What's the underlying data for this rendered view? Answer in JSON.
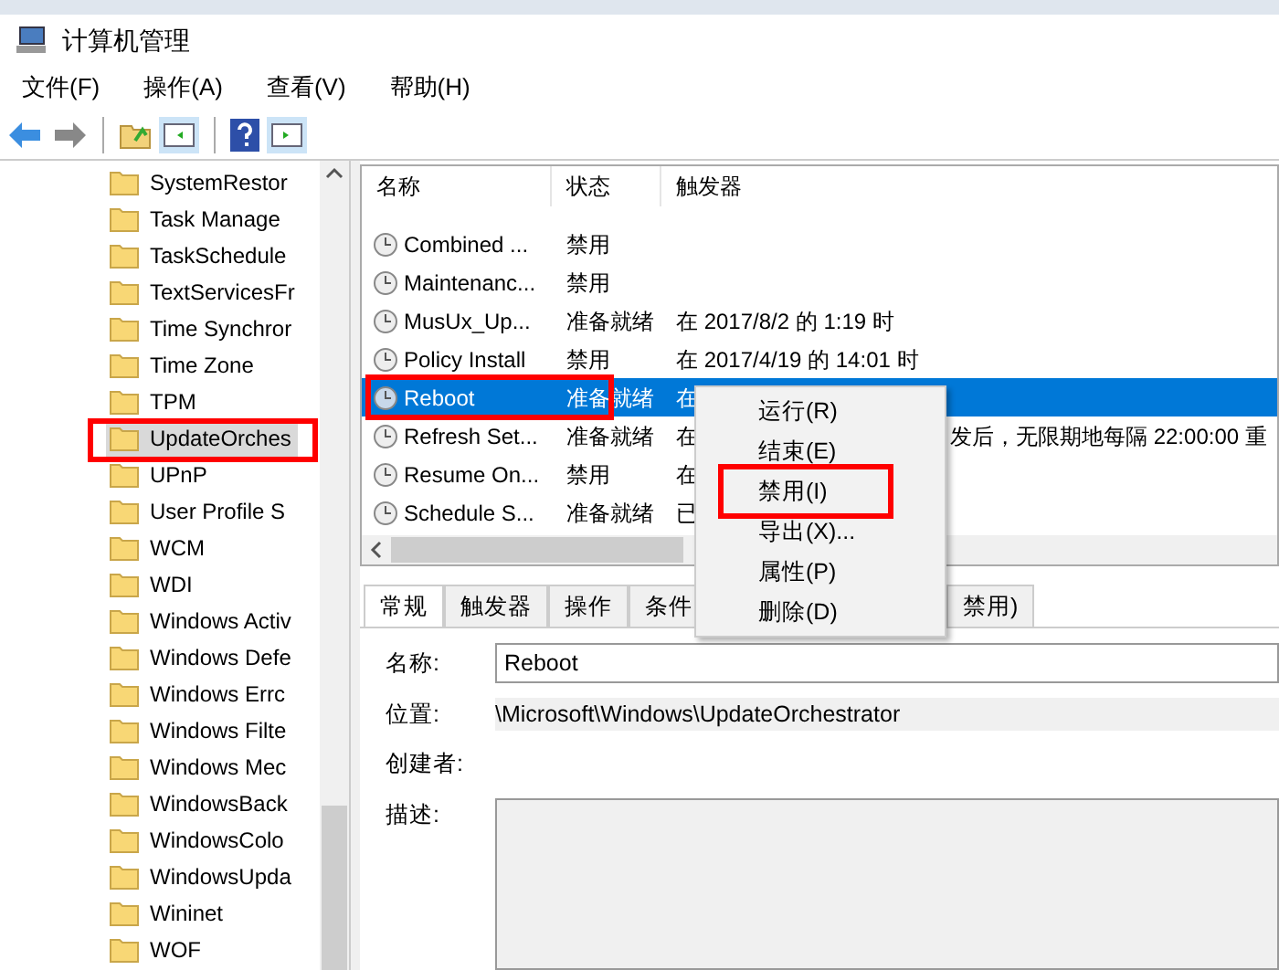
{
  "window": {
    "title": "计算机管理"
  },
  "menu_bar": [
    "文件(F)",
    "操作(A)",
    "查看(V)",
    "帮助(H)"
  ],
  "tree": {
    "items": [
      {
        "label": "SystemRestor",
        "selected": false,
        "highlighted": false
      },
      {
        "label": "Task Manage",
        "selected": false,
        "highlighted": false
      },
      {
        "label": "TaskSchedule",
        "selected": false,
        "highlighted": false
      },
      {
        "label": "TextServicesFr",
        "selected": false,
        "highlighted": false
      },
      {
        "label": "Time Synchror",
        "selected": false,
        "highlighted": false
      },
      {
        "label": "Time Zone",
        "selected": false,
        "highlighted": false
      },
      {
        "label": "TPM",
        "selected": false,
        "highlighted": false
      },
      {
        "label": "UpdateOrches",
        "selected": true,
        "highlighted": true
      },
      {
        "label": "UPnP",
        "selected": false,
        "highlighted": false
      },
      {
        "label": "User Profile S",
        "selected": false,
        "highlighted": false
      },
      {
        "label": "WCM",
        "selected": false,
        "highlighted": false
      },
      {
        "label": "WDI",
        "selected": false,
        "highlighted": false
      },
      {
        "label": "Windows Activ",
        "selected": false,
        "highlighted": false
      },
      {
        "label": "Windows Defe",
        "selected": false,
        "highlighted": false
      },
      {
        "label": "Windows Errc",
        "selected": false,
        "highlighted": false
      },
      {
        "label": "Windows Filte",
        "selected": false,
        "highlighted": false
      },
      {
        "label": "Windows Mec",
        "selected": false,
        "highlighted": false
      },
      {
        "label": "WindowsBack",
        "selected": false,
        "highlighted": false
      },
      {
        "label": "WindowsColo",
        "selected": false,
        "highlighted": false
      },
      {
        "label": "WindowsUpda",
        "selected": false,
        "highlighted": false
      },
      {
        "label": "Wininet",
        "selected": false,
        "highlighted": false
      },
      {
        "label": "WOF",
        "selected": false,
        "highlighted": false
      }
    ]
  },
  "task_table": {
    "columns": [
      "名称",
      "状态",
      "触发器"
    ],
    "rows": [
      {
        "name": "Combined ...",
        "status": "禁用",
        "trigger": "",
        "trigger_tail": "",
        "selected": false,
        "highlighted": false
      },
      {
        "name": "Maintenanc...",
        "status": "禁用",
        "trigger": "",
        "trigger_tail": "",
        "selected": false,
        "highlighted": false
      },
      {
        "name": "MusUx_Up...",
        "status": "准备就绪",
        "trigger": "在 2017/8/2 的 1:19 时",
        "trigger_tail": "",
        "selected": false,
        "highlighted": false
      },
      {
        "name": "Policy Install",
        "status": "禁用",
        "trigger": "在 2017/4/19 的 14:01 时",
        "trigger_tail": "",
        "selected": false,
        "highlighted": false
      },
      {
        "name": "Reboot",
        "status": "准备就绪",
        "trigger": "在",
        "trigger_tail": "",
        "selected": true,
        "highlighted": true
      },
      {
        "name": "Refresh Set...",
        "status": "准备就绪",
        "trigger": "在",
        "trigger_tail": "发后，无限期地每隔 22:00:00 重",
        "selected": false,
        "highlighted": false
      },
      {
        "name": "Resume On...",
        "status": "禁用",
        "trigger": "在",
        "trigger_tail": "",
        "selected": false,
        "highlighted": false
      },
      {
        "name": "Schedule S...",
        "status": "准备就绪",
        "trigger": "已",
        "trigger_tail": "",
        "selected": false,
        "highlighted": false
      }
    ]
  },
  "context_menu": [
    {
      "label": "运行(R)",
      "highlighted": false
    },
    {
      "label": "结束(E)",
      "highlighted": false
    },
    {
      "label": "禁用(I)",
      "highlighted": true
    },
    {
      "label": "导出(X)...",
      "highlighted": false
    },
    {
      "label": "属性(P)",
      "highlighted": false
    },
    {
      "label": "删除(D)",
      "highlighted": false
    }
  ],
  "detail_tabs": [
    {
      "label": "常规",
      "selected": true
    },
    {
      "label": "触发器",
      "selected": false
    },
    {
      "label": "操作",
      "selected": false
    },
    {
      "label": "条件",
      "selected": false
    },
    {
      "label": "禁用)",
      "selected": false
    }
  ],
  "general": {
    "name_label": "名称:",
    "name_value": "Reboot",
    "location_label": "位置:",
    "location_value": "\\Microsoft\\Windows\\UpdateOrchestrator",
    "author_label": "创建者:",
    "description_label": "描述:"
  }
}
